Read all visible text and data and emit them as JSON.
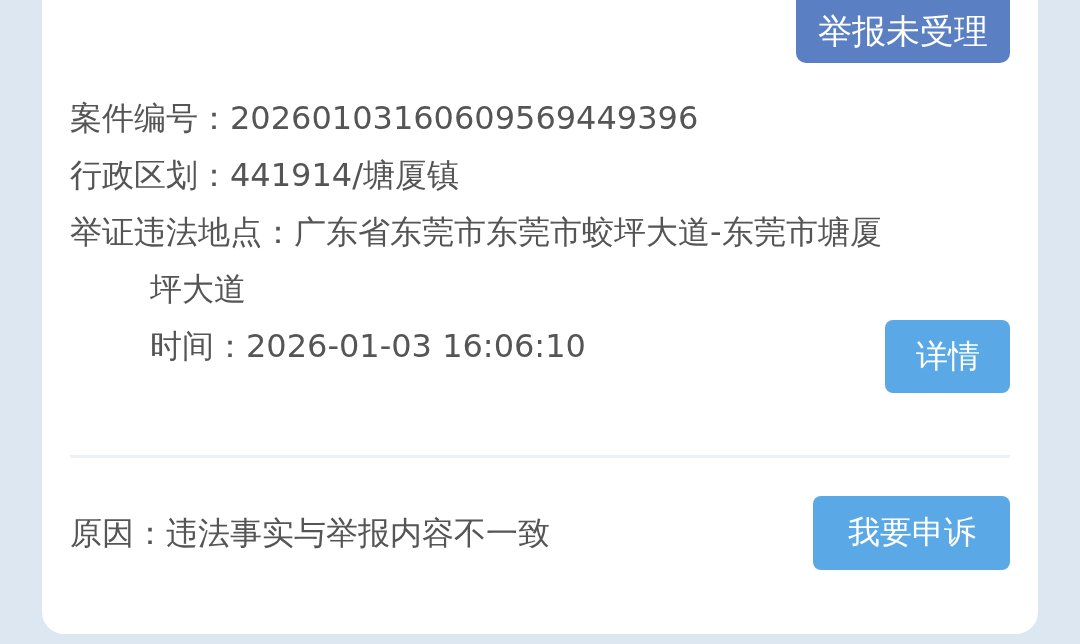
{
  "status_badge": "举报未受理",
  "fields": [
    {
      "label": "案件编号：",
      "value": "20260103160609569449396"
    },
    {
      "label": "行政区划：",
      "value": "441914/塘厦镇"
    },
    {
      "label": "举证违法地点：",
      "value": "广东省东莞市东莞市蛟坪大道-东莞市塘厦"
    }
  ],
  "address_continuation": "坪大道",
  "time": {
    "label": "时间：",
    "value": "2026-01-03 16:06:10"
  },
  "detail_button": "详情",
  "reason": {
    "label": "原因：",
    "value": "违法事实与举报内容不一致"
  },
  "appeal_button": "我要申诉"
}
